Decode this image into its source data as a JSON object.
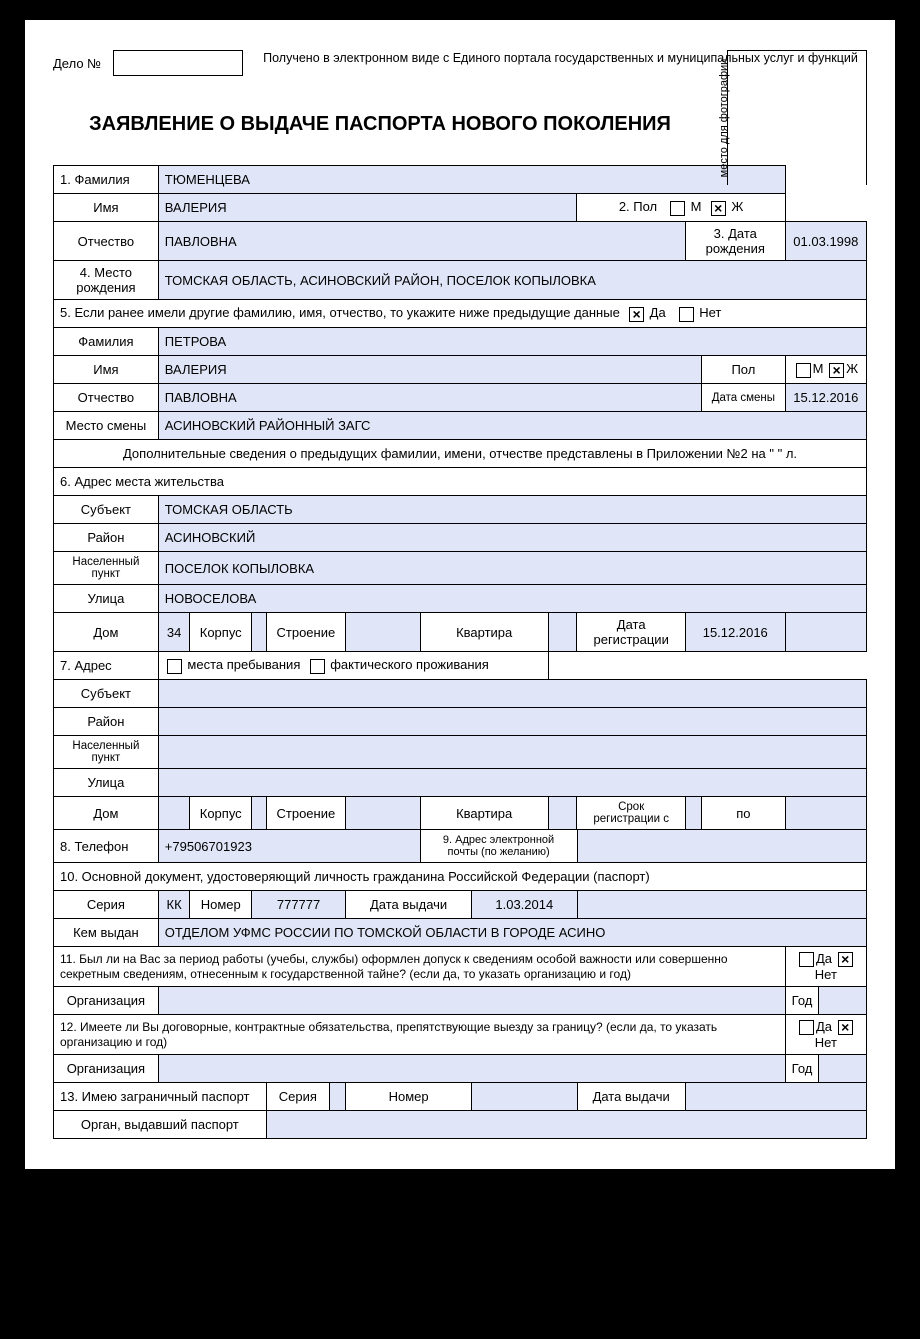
{
  "header": {
    "delo_label": "Дело №",
    "received": "Получено в электронном виде с Единого портала государственных и муниципальных услуг и функций",
    "photo_label": "место для фотографии"
  },
  "title": "ЗАЯВЛЕНИЕ О ВЫДАЧЕ ПАСПОРТА НОВОГО ПОКОЛЕНИЯ",
  "r1": {
    "label": "1. Фамилия",
    "val": "ТЮМЕНЦЕВА"
  },
  "r2": {
    "label": "Имя",
    "val": "ВАЛЕРИЯ",
    "pol_label": "2. Пол",
    "m": "М",
    "zh": "Ж"
  },
  "r3": {
    "label": "Отчество",
    "val": "ПАВЛОВНА",
    "dob_label": "3. Дата рождения",
    "dob": "01.03.1998"
  },
  "r4": {
    "label": "4. Место рождения",
    "val": "ТОМСКАЯ ОБЛАСТЬ, АСИНОВСКИЙ РАЙОН, ПОСЕЛОК КОПЫЛОВКА"
  },
  "r5": {
    "text": "5. Если ранее имели другие фамилию, имя, отчество, то укажите ниже предыдущие данные",
    "da": "Да",
    "net": "Нет"
  },
  "p_fam": {
    "label": "Фамилия",
    "val": "ПЕТРОВА"
  },
  "p_imya": {
    "label": "Имя",
    "val": "ВАЛЕРИЯ",
    "pol_label": "Пол",
    "m": "М",
    "zh": "Ж"
  },
  "p_otch": {
    "label": "Отчество",
    "val": "ПАВЛОВНА",
    "ds_label": "Дата смены",
    "ds": "15.12.2016"
  },
  "p_mesto": {
    "label": "Место смены",
    "val": "АСИНОВСКИЙ РАЙОННЫЙ ЗАГС"
  },
  "p_dop": "Дополнительные сведения о предыдущих фамилии, имени, отчестве представлены в Приложении №2 на \"       \" л.",
  "r6": "6. Адрес места жительства",
  "a_subj": {
    "label": "Субъект",
    "val": "ТОМСКАЯ ОБЛАСТЬ"
  },
  "a_raion": {
    "label": "Район",
    "val": "АСИНОВСКИЙ"
  },
  "a_np": {
    "label": "Населенный пункт",
    "val": "ПОСЕЛОК КОПЫЛОВКА"
  },
  "a_ul": {
    "label": "Улица",
    "val": "НОВОСЕЛОВА"
  },
  "a_dom": {
    "label": "Дом",
    "val": "34",
    "korpus": "Корпус",
    "stroenie": "Строение",
    "kvartira": "Квартира",
    "dreg_label": "Дата регистрации",
    "dreg": "15.12.2016"
  },
  "r7": {
    "label": "7. Адрес",
    "mp": "места пребывания",
    "fp": "фактического проживания"
  },
  "b_subj": {
    "label": "Субъект"
  },
  "b_raion": {
    "label": "Район"
  },
  "b_np": {
    "label": "Населенный пункт"
  },
  "b_ul": {
    "label": "Улица"
  },
  "b_dom": {
    "label": "Дом",
    "korpus": "Корпус",
    "stroenie": "Строение",
    "kvartira": "Квартира",
    "sreg_label": "Срок регистрации с",
    "po": "по"
  },
  "r8": {
    "label": "8. Телефон",
    "val": "+79506701923",
    "email_label": "9. Адрес электронной почты (по желанию)"
  },
  "r10": "10. Основной документ, удостоверяющий личность гражданина Российской Федерации (паспорт)",
  "pass": {
    "seria_label": "Серия",
    "seria": "КК",
    "nomer_label": "Номер",
    "nomer": "777777",
    "dv_label": "Дата выдачи",
    "dv": "1.03.2014"
  },
  "kem": {
    "label": "Кем выдан",
    "val": "ОТДЕЛОМ УФМС РОССИИ ПО ТОМСКОЙ ОБЛАСТИ В ГОРОДЕ АСИНО"
  },
  "r11": {
    "text": "11. Был ли на Вас за период работы (учебы, службы) оформлен допуск к сведениям особой важности или совершенно секретным сведениям, отнесенным к государственной тайне? (если да, то указать организацию и год)",
    "da": "Да",
    "net": "Нет"
  },
  "r11o": {
    "label": "Организация",
    "god": "Год"
  },
  "r12": {
    "text": "12. Имеете ли Вы договорные, контрактные обязательства, препятствующие выезду за границу? (если да, то указать организацию и год)",
    "da": "Да",
    "net": "Нет"
  },
  "r12o": {
    "label": "Организация",
    "god": "Год"
  },
  "r13": {
    "text": "13. Имею заграничный паспорт",
    "seria": "Серия",
    "nomer": "Номер",
    "dv": "Дата выдачи"
  },
  "r13b": "Орган, выдавший паспорт"
}
